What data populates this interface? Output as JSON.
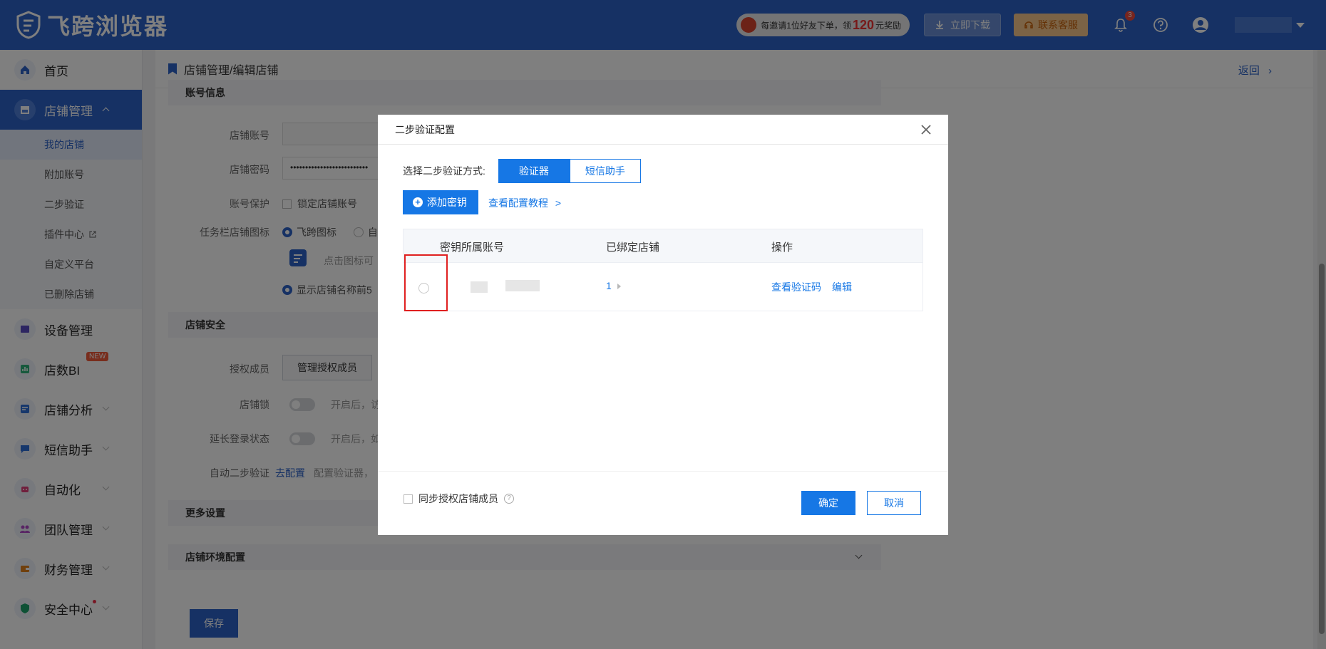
{
  "brand": {
    "name": "飞跨浏览器"
  },
  "topbar": {
    "promo_text_before": "每邀请1位好友下单，领",
    "promo_amount": "120",
    "promo_text_after": "元奖励",
    "download_label": "立即下载",
    "service_label": "联系客服",
    "notification_count": "3"
  },
  "sidebar": {
    "items": [
      {
        "label": "首页",
        "icon": "home-icon"
      },
      {
        "label": "店铺管理",
        "icon": "store-icon",
        "expanded": true,
        "children": [
          {
            "label": "我的店铺",
            "active": true
          },
          {
            "label": "附加账号"
          },
          {
            "label": "二步验证"
          },
          {
            "label": "插件中心"
          },
          {
            "label": "自定义平台"
          },
          {
            "label": "已删除店铺"
          }
        ]
      },
      {
        "label": "设备管理",
        "icon": "device-icon"
      },
      {
        "label": "店数BI",
        "icon": "chart-icon",
        "tag": "NEW"
      },
      {
        "label": "店铺分析",
        "icon": "analysis-icon"
      },
      {
        "label": "短信助手",
        "icon": "sms-icon"
      },
      {
        "label": "自动化",
        "icon": "robot-icon"
      },
      {
        "label": "团队管理",
        "icon": "team-icon"
      },
      {
        "label": "财务管理",
        "icon": "wallet-icon"
      },
      {
        "label": "安全中心",
        "icon": "shield-icon"
      }
    ]
  },
  "page": {
    "breadcrumb": "店铺管理/编辑店铺",
    "back_label": "返回",
    "section_account": "账号信息",
    "label_account": "店铺账号",
    "label_password": "店铺密码",
    "password_mask": "••••••••••••••••••••••••••",
    "label_protect": "账号保护",
    "lock_account": "锁定店铺账号",
    "label_taskbar_icon": "任务栏店铺图标",
    "opt_feikua_icon": "飞跨图标",
    "opt_custom_short": "自",
    "icon_hint": "点击图标可",
    "show_name": "显示店铺名称前5",
    "section_security": "店铺安全",
    "label_members": "授权成员",
    "manage_members": "管理授权成员",
    "label_lock": "店铺锁",
    "lock_hint": "开启后，访",
    "label_extend": "延长登录状态",
    "extend_hint": "开启后，如",
    "label_auto_2fa": "自动二步验证",
    "go_config": "去配置",
    "auto_2fa_hint": "配置验证器，",
    "section_more": "更多设置",
    "section_env": "店铺环境配置",
    "save_label": "保存"
  },
  "modal": {
    "title": "二步验证配置",
    "mode_label": "选择二步验证方式:",
    "mode_options": [
      "验证器",
      "短信助手"
    ],
    "add_key_label": "添加密钥",
    "tutorial_label": "查看配置教程",
    "tutorial_arrow": ">",
    "table": {
      "headers": [
        "密钥所属账号",
        "已绑定店铺",
        "操作"
      ],
      "rows": [
        {
          "bound_count": "1",
          "actions": [
            "查看验证码",
            "编辑"
          ]
        }
      ]
    },
    "sync_label": "同步授权店铺成员",
    "confirm_label": "确定",
    "cancel_label": "取消"
  },
  "colors": {
    "brand": "#2d63c8",
    "primary": "#1677e5",
    "danger": "#e02020"
  }
}
